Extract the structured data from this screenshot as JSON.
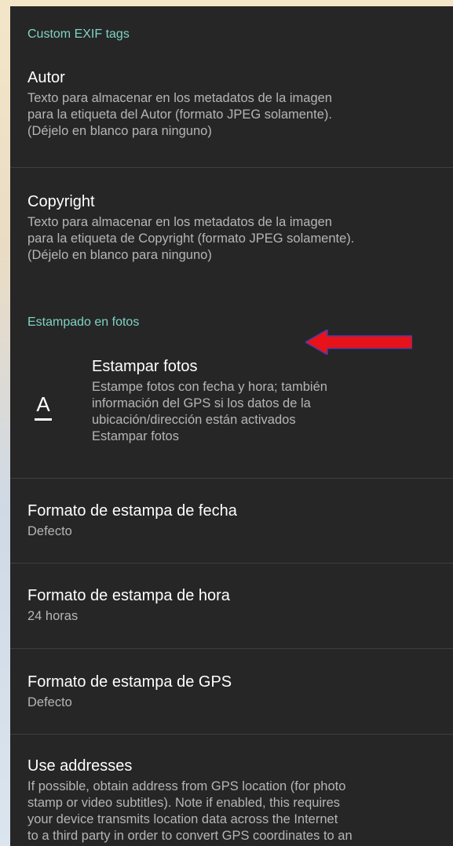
{
  "sections": {
    "exif_header": "Custom EXIF tags",
    "stamp_header": "Estampado en fotos"
  },
  "prefs": {
    "autor": {
      "title": "Autor",
      "summary": [
        "Texto para almacenar en los metadatos de la imagen",
        "para la etiqueta del Autor (formato JPEG solamente).",
        "(Déjelo en blanco para ninguno)"
      ]
    },
    "copyright": {
      "title": "Copyright",
      "summary": [
        "Texto para almacenar en los metadatos de la imagen",
        "para la etiqueta de Copyright (formato JPEG solamente).",
        "(Déjelo en blanco para ninguno)"
      ]
    },
    "estampar": {
      "icon": "A",
      "title": "Estampar fotos",
      "summary": [
        "Estampe fotos con fecha y hora; también",
        "información del GPS si los datos de la",
        "ubicación/dirección están activados",
        "Estampar fotos"
      ]
    },
    "fecha": {
      "title": "Formato de estampa de fecha",
      "summary": "Defecto"
    },
    "hora": {
      "title": "Formato de estampa de hora",
      "summary": "24 horas"
    },
    "gps": {
      "title": "Formato de estampa de GPS",
      "summary": "Defecto"
    },
    "addresses": {
      "title": "Use addresses",
      "summary": [
        "If possible, obtain address from GPS location (for photo",
        "stamp or video subtitles). Note if enabled, this requires",
        "your device transmits location data across the Internet",
        "to a third party in order to convert GPS coordinates to an"
      ]
    }
  },
  "colors": {
    "accent": "#7fd3c4",
    "arrow": "#e8121a",
    "panel": "#262626"
  }
}
